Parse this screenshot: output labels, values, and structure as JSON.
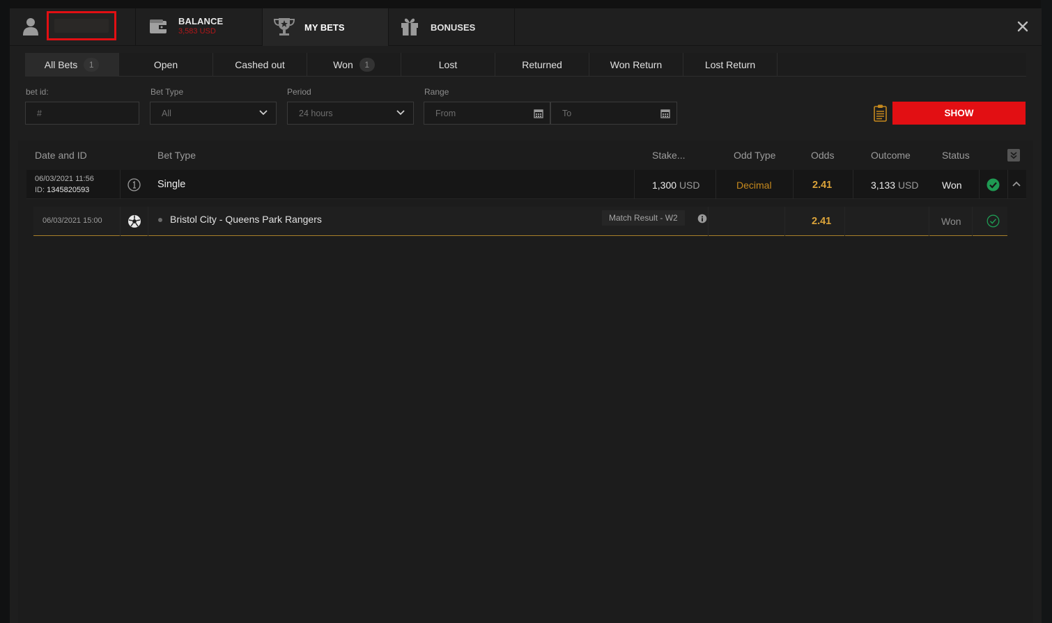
{
  "header": {
    "balance_title": "BALANCE",
    "balance_amount": "3,583 USD",
    "mybets_label": "MY BETS",
    "bonuses_label": "BONUSES",
    "close_icon": "close-icon"
  },
  "tabs": [
    {
      "label": "All Bets",
      "count": "1"
    },
    {
      "label": "Open"
    },
    {
      "label": "Cashed out"
    },
    {
      "label": "Won",
      "count": "1"
    },
    {
      "label": "Lost"
    },
    {
      "label": "Returned"
    },
    {
      "label": "Won Return"
    },
    {
      "label": "Lost Return"
    }
  ],
  "filters": {
    "bet_id_label": "bet id:",
    "bet_id_placeholder": "#",
    "bet_type_label": "Bet Type",
    "bet_type_value": "All",
    "period_label": "Period",
    "period_value": "24 hours",
    "range_label": "Range",
    "from_placeholder": "From",
    "to_placeholder": "To",
    "show_label": "SHOW"
  },
  "table": {
    "columns": {
      "date_id": "Date and ID",
      "bet_type": "Bet Type",
      "stake": "Stake...",
      "odd_type": "Odd Type",
      "odds": "Odds",
      "outcome": "Outcome",
      "status": "Status"
    },
    "bet": {
      "datetime": "06/03/2021 11:56",
      "id_label": "ID:",
      "id": "1345820593",
      "type": "Single",
      "stake_value": "1,300",
      "currency": "USD",
      "odd_type": "Decimal",
      "odds": "2.41",
      "outcome_value": "3,133",
      "status": "Won"
    },
    "event": {
      "datetime": "06/03/2021 15:00",
      "name": "Bristol City - Queens Park Rangers",
      "market": "Match Result - W2",
      "odds": "2.41",
      "status": "Won"
    }
  },
  "colors": {
    "accent_red": "#e20f13",
    "odds_gold": "#dca43a",
    "won_green": "#1f9a53"
  }
}
